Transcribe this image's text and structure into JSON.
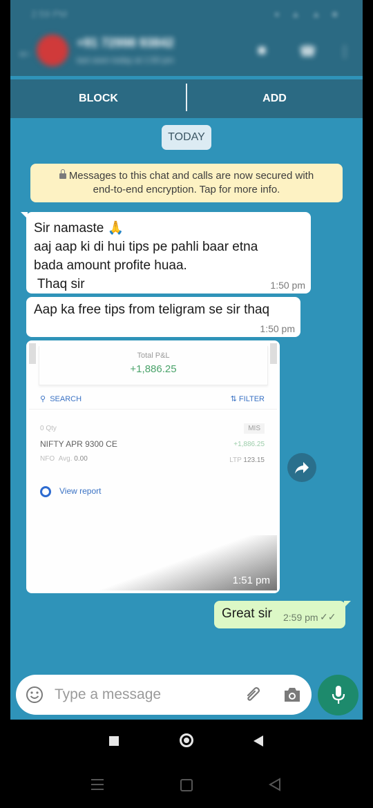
{
  "status_bar": {
    "time": "2:59 PM",
    "icons": "● ▲ ▲ ■"
  },
  "header": {
    "contact_name": "+91 72998 93842",
    "subtitle": "last seen today at 1:50 pm"
  },
  "actions": {
    "block": "BLOCK",
    "add": "ADD"
  },
  "date_chip": "TODAY",
  "encryption_notice": {
    "line1": "Messages to this chat and calls are now secured with",
    "line2": "end-to-end encryption. Tap for more info."
  },
  "messages": [
    {
      "direction": "incoming",
      "text": "Sir namaste 🙏\naaj aap ki di hui tips pe pahli baar etna\nbada amount profite huaa.\n Thaq sir",
      "time": "1:50 pm"
    },
    {
      "direction": "incoming",
      "text": "Aap ka free tips from teligram se sir thaq",
      "time": "1:50 pm"
    },
    {
      "direction": "outgoing",
      "text": "Great sir",
      "time": "2:59 pm",
      "ticks": "✓✓"
    }
  ],
  "image_message": {
    "time": "1:51 pm",
    "pl_title": "Total P&L",
    "pl_value": "+1,886.25",
    "search_label": "SEARCH",
    "filter_label": "FILTER",
    "qty": "0 Qty",
    "product": "MIS",
    "instrument": "NIFTY APR 9300 CE",
    "position_pnl": "+1,886.25",
    "exchange": "NFO",
    "avg_label": "Avg.",
    "avg_value": "0.00",
    "ltp_label": "LTP",
    "ltp_value": "123.15",
    "report_label": "View report"
  },
  "composer": {
    "placeholder": "Type a message"
  },
  "colors": {
    "chat_background": "#2f93b9",
    "header": "#2b6a83",
    "incoming_bubble": "#ffffff",
    "outgoing_bubble": "#dcf8c6",
    "encryption_notice": "#fdf2c3",
    "mic_button": "#1d8a6c"
  },
  "icons": [
    "back-arrow-icon",
    "avatar",
    "video-call-icon",
    "phone-icon",
    "more-vert-icon",
    "lock-icon",
    "forward-icon",
    "emoji-icon",
    "attach-icon",
    "camera-icon",
    "mic-icon"
  ]
}
